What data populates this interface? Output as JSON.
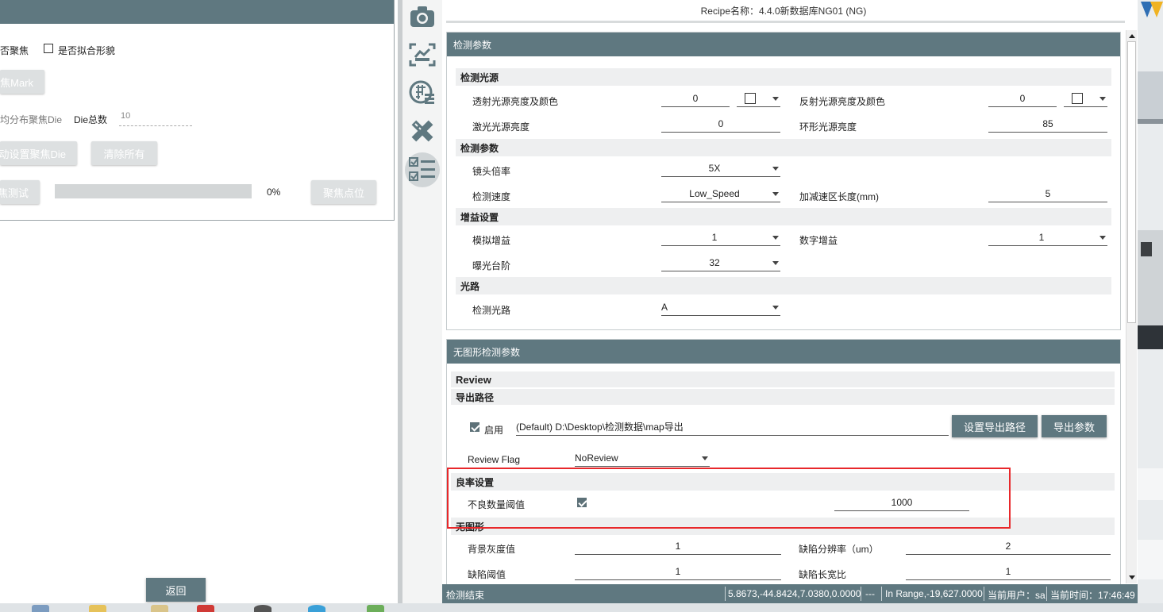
{
  "left": {
    "focus_label": "否聚焦",
    "fit_label": "是否拟合形貌",
    "mark_button": "焦Mark",
    "distribute_label": "均分布聚焦Die",
    "die_total_label": "Die总数",
    "die_total_value": "10",
    "auto_set_button": "动设置聚焦Die",
    "clear_all_button": "清除所有",
    "focus_test_button": "焦测试",
    "progress_text": "0%",
    "progress_value": 0,
    "focus_point_button": "聚焦点位",
    "back_button": "返回"
  },
  "toolbar": {
    "icons": [
      "camera-icon",
      "chart-icon",
      "wafer-map-icon",
      "ruler-pencil-icon",
      "checklist-icon"
    ]
  },
  "recipe_title": "Recipe名称：4.4.0新数据库NG01 (NG)",
  "detect_panel": {
    "header": "检测参数",
    "light_section": "检测光源",
    "trans_light_label": "透射光源亮度及颜色",
    "trans_light_value": "0",
    "refl_light_label": "反射光源亮度及颜色",
    "refl_light_value": "0",
    "laser_label": "激光光源亮度",
    "laser_value": "0",
    "ring_label": "环形光源亮度",
    "ring_value": "85",
    "param_section": "检测参数",
    "lens_label": "镜头倍率",
    "lens_value": "5X",
    "speed_label": "检测速度",
    "speed_value": "Low_Speed",
    "accel_label": "加减速区长度(mm)",
    "accel_value": "5",
    "gain_section": "增益设置",
    "analog_gain_label": "模拟增益",
    "analog_gain_value": "1",
    "digital_gain_label": "数字增益",
    "digital_gain_value": "1",
    "exposure_label": "曝光台阶",
    "exposure_value": "32",
    "optical_section": "光路",
    "optical_label": "检测光路",
    "optical_value": "A"
  },
  "nopattern_panel": {
    "header": "无图形检测参数",
    "review_section": "Review",
    "export_section": "导出路径",
    "enable_label": "启用",
    "enable_checked": true,
    "export_path": "(Default) D:\\Desktop\\检测数据\\map导出",
    "set_path_button": "设置导出路径",
    "export_params_button": "导出参数",
    "review_flag_label": "Review Flag",
    "review_flag_value": "NoReview",
    "yield_section": "良率设置",
    "defect_threshold_label": "不良数量阈值",
    "defect_threshold_checked": true,
    "defect_threshold_value": "1000",
    "nopattern_section": "无图形",
    "bg_gray_label": "背景灰度值",
    "bg_gray_value": "1",
    "defect_res_label": "缺陷分辨率（um）",
    "defect_res_value": "2",
    "defect_thr_label": "缺陷阈值",
    "defect_thr_value": "1",
    "defect_ratio_label": "缺陷长宽比",
    "defect_ratio_value": "1"
  },
  "status": {
    "state": "检测结束",
    "coords": "5.8673,-44.8424,7.0380,0.0000",
    "dashes": "---",
    "range": "In Range,-19,627.0000",
    "user": "当前用户：sa",
    "time": "当前时间：17:46:49"
  },
  "colors": {
    "header": "#5f7880",
    "highlight": "#e8282b",
    "section": "#eeeff0"
  }
}
